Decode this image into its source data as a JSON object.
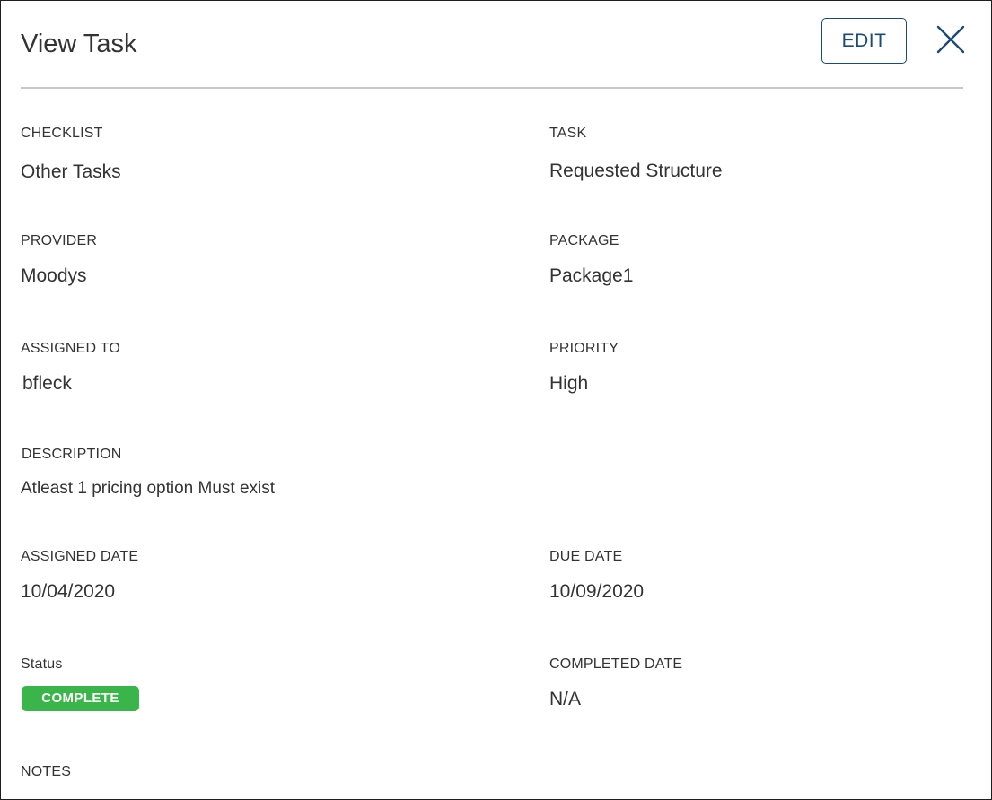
{
  "header": {
    "title": "View Task",
    "edit_label": "EDIT",
    "close_icon": "close-icon"
  },
  "fields": {
    "checklist": {
      "label": "CHECKLIST",
      "value": "Other Tasks"
    },
    "task": {
      "label": "TASK",
      "value": "Requested Structure"
    },
    "provider": {
      "label": "PROVIDER",
      "value": "Moodys"
    },
    "package": {
      "label": "PACKAGE",
      "value": "Package1"
    },
    "assigned_to": {
      "label": "ASSIGNED TO",
      "value": "bfleck"
    },
    "priority": {
      "label": "PRIORITY",
      "value": "High"
    },
    "description": {
      "label": "DESCRIPTION",
      "value": "Atleast 1 pricing option Must exist"
    },
    "assigned_date": {
      "label": "ASSIGNED DATE",
      "value": "10/04/2020"
    },
    "due_date": {
      "label": "DUE DATE",
      "value": "10/09/2020"
    },
    "status": {
      "label": "Status",
      "value": "COMPLETE",
      "color": "#3ab54a"
    },
    "completed_date": {
      "label": "COMPLETED DATE",
      "value": "N/A"
    },
    "notes": {
      "label": "NOTES"
    }
  },
  "colors": {
    "accent": "#1b4a73",
    "status_complete": "#3ab54a",
    "divider": "#c8c8c8"
  }
}
